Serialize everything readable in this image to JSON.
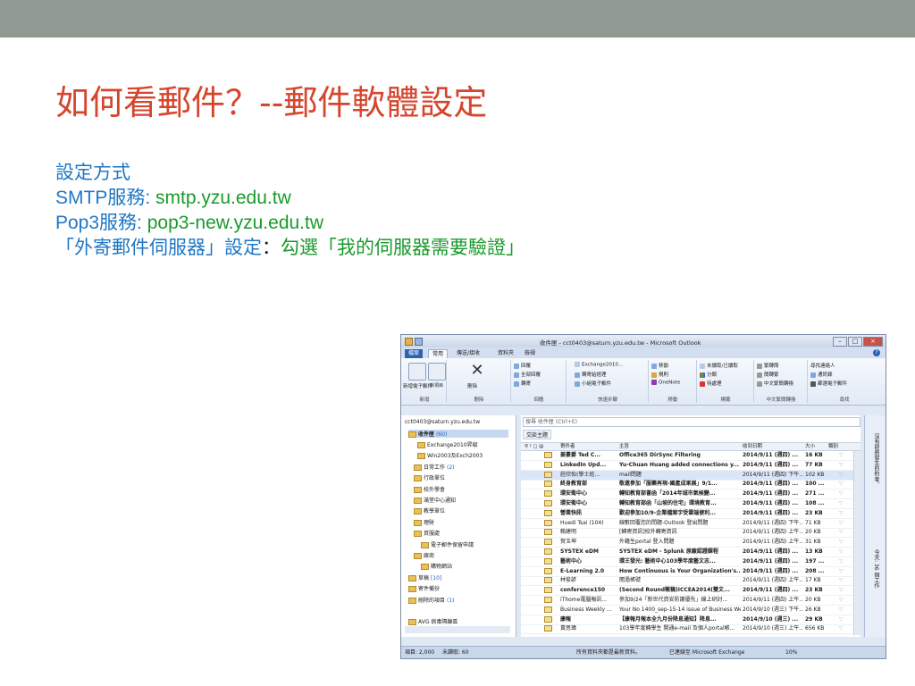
{
  "slide": {
    "title": "如何看郵件？--郵件軟體設定",
    "lines": {
      "l1": "設定方式",
      "l2a": "SMTP服務: ",
      "l2b": "smtp.yzu.edu.tw",
      "l3a": "Pop3服務: ",
      "l3b": "pop3-new.yzu.edu.tw",
      "l4a": "「外寄郵件伺服器」設定",
      "l4b": "：",
      "l4c": "勾選「我的伺服器需要驗證」"
    }
  },
  "outlook": {
    "window_title": "收件匣 - cct0403@saturn.yzu.edu.tw - Microsoft Outlook",
    "tabs": [
      "檔案",
      "常用",
      "傳送/接收",
      "資料夾",
      "檢視"
    ],
    "ribbon": {
      "new_group": "新增",
      "new_mail": "新增電子郵件",
      "new_items": "新項目",
      "delete_group": "刪除",
      "delete": "刪除",
      "respond_group": "回應",
      "reply": "回覆",
      "reply_all": "全部回覆",
      "forward": "轉寄",
      "quicksteps_group": "快速步驟",
      "qs1": "Exchange2010...",
      "qs2": "轉寄給經理",
      "qs3": "小組電子郵件",
      "move_group": "移動",
      "move": "移動",
      "rules": "規則",
      "onenote": "OneNote",
      "tags_group": "標籤",
      "unread": "未讀取/已讀取",
      "categorize": "分類",
      "followup": "待處理",
      "chinese_group": "中文繁簡轉換",
      "to_trad": "繁轉簡",
      "to_simp": "簡轉繁",
      "conv": "中文繁簡轉換",
      "find_group": "尋找",
      "find_contact": "尋找連絡人",
      "address_book": "通訊錄",
      "filter": "篩選電子郵件"
    },
    "nav": {
      "account": "cct0403@saturn.yzu.edu.tw",
      "inbox": "收件匣",
      "inbox_count": "(60)",
      "items": [
        {
          "label": "Exchange2010昇級",
          "count": ""
        },
        {
          "label": "Win2003及Exch2003",
          "count": ""
        },
        {
          "label": "日常工作",
          "count": "(2)"
        },
        {
          "label": "行政單位",
          "count": ""
        },
        {
          "label": "校外學會",
          "count": ""
        },
        {
          "label": "滿堂中心通知",
          "count": ""
        },
        {
          "label": "教學單位",
          "count": ""
        },
        {
          "label": "理財",
          "count": ""
        },
        {
          "label": "資服處",
          "count": ""
        },
        {
          "label": "電子郵件保留申請",
          "count": ""
        },
        {
          "label": "廠商",
          "count": ""
        },
        {
          "label": "購物網站",
          "count": ""
        },
        {
          "label": "草稿",
          "count": "[10]"
        },
        {
          "label": "寄件備份",
          "count": ""
        },
        {
          "label": "刪除的項目",
          "count": "(1)"
        }
      ],
      "avg": "AVG 病毒隔離區"
    },
    "list": {
      "search_placeholder": "搜尋 收件匣 (Ctrl+E)",
      "arrange": "交談主題",
      "headers": {
        "from": "寄件者",
        "subject": "主旨",
        "received": "收到日期",
        "size": "大小",
        "category": "類別"
      },
      "rows": [
        {
          "from": "姜豪爵 Ted C...",
          "subject": "Office365 DirSync Filtering",
          "received": "2014/9/11 (週四) ...",
          "size": "16 KB",
          "bold": true
        },
        {
          "from": "LinkedIn Upd...",
          "subject": "Yu-Chuan Huang added connections y...",
          "received": "2014/9/11 (週四) ...",
          "size": "77 KB",
          "bold": true
        },
        {
          "from": "莊欣怡(學士班...",
          "subject": "mail問題",
          "received": "2014/9/11 (週四) 下午...",
          "size": "102 KB",
          "bold": false,
          "sel": true
        },
        {
          "from": "終身教育部",
          "subject": "敬邀參加「服藥再現-國產成果展」9/1...",
          "received": "2014/9/11 (週四) ...",
          "size": "100 ...",
          "bold": true
        },
        {
          "from": "環安衛中心",
          "subject": "轉知教育部書函「2014年城市氣候變...",
          "received": "2014/9/11 (週四) ...",
          "size": "271 ...",
          "bold": true
        },
        {
          "from": "環安衛中心",
          "subject": "轉知教育部函「山坡的住宅」環境教育...",
          "received": "2014/9/11 (週四) ...",
          "size": "108 ...",
          "bold": true
        },
        {
          "from": "營業快訊",
          "subject": "歡迎參加10/9-企業檔案字受雲端便利...",
          "received": "2014/9/11 (週四) ...",
          "size": "23 KB",
          "bold": true
        },
        {
          "from": "Huedi Tsai (104)",
          "subject": "線數回覆您的問題-Outlook 登出問題",
          "received": "2014/9/11 (週四) 下午...",
          "size": "71 KB",
          "bold": false
        },
        {
          "from": "賴建明",
          "subject": "[轉寄資訊]校外轉寄資訊",
          "received": "2014/9/11 (週四) 上午...",
          "size": "20 KB",
          "bold": false
        },
        {
          "from": "賀玉坤",
          "subject": "外籍生portal 登入問題",
          "received": "2014/9/11 (週四) 上午...",
          "size": "31 KB",
          "bold": false
        },
        {
          "from": "SYSTEX eDM",
          "subject": "SYSTEX eDM - Splunk 原廠認證課程",
          "received": "2014/9/11 (週四) ...",
          "size": "13 KB",
          "bold": true
        },
        {
          "from": "藝術中心",
          "subject": "環王發光: 藝術中心103學年度藝文志...",
          "received": "2014/9/11 (週四) ...",
          "size": "197 ...",
          "bold": true
        },
        {
          "from": "E-Learning 2.0",
          "subject": "How Continuous is Your Organization's...",
          "received": "2014/9/11 (週四) ...",
          "size": "208 ...",
          "bold": true
        },
        {
          "from": "林俊諺",
          "subject": "閱過帳號",
          "received": "2014/9/11 (週四) 上午...",
          "size": "17 KB",
          "bold": false
        },
        {
          "from": "conference150",
          "subject": "(Second Round徵稿)ICCEA2014(雙文...",
          "received": "2014/9/11 (週四) ...",
          "size": "23 KB",
          "bold": true
        },
        {
          "from": "iThome電腦報訊...",
          "subject": "參加9/24「新世代資安防護優先」線上研討...",
          "received": "2014/9/11 (週四) 上午...",
          "size": "20 KB",
          "bold": false
        },
        {
          "from": "Business Weekly ...",
          "subject": "Your No 1400_sep-15-14 issue of Business We...",
          "received": "2014/9/10 (週三) 下午...",
          "size": "26 KB",
          "bold": false
        },
        {
          "from": "康報",
          "subject": "【康報月報本全九月份降息通知】降息...",
          "received": "2014/9/10 (週三) ...",
          "size": "29 KB",
          "bold": true
        },
        {
          "from": "黃思瑋",
          "subject": "103學年度轉學生 開通e-mail 及個人portal帳...",
          "received": "2014/9/10 (週三) 上午...",
          "size": "656 KB",
          "bold": false
        }
      ]
    },
    "todo": {
      "t1": "沒有即將發生的約會。",
      "t2": "今天: 36 個工作"
    },
    "status": {
      "items": "項目: 2,000",
      "unread": "未讀取: 60",
      "updated": "所有資料夾都是最新資料。",
      "connected": "已連線至 Microsoft Exchange",
      "zoom": "10%"
    }
  }
}
